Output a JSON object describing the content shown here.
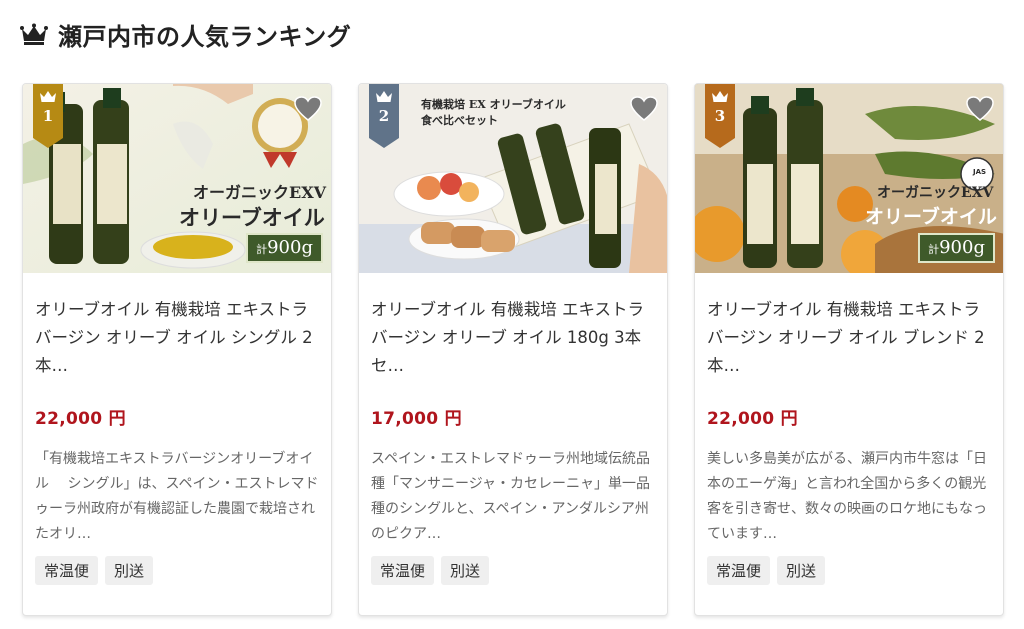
{
  "header": {
    "title": "瀬戸内市の人気ランキング",
    "icon": "crown-icon"
  },
  "colors": {
    "price": "#b0151d",
    "gold": "#b68a14",
    "silver": "#607389",
    "bronze": "#b66a1c"
  },
  "cards": [
    {
      "rank": "1",
      "badge": "gold",
      "image_text": {
        "line1": "オーガニックEXV",
        "line2": "オリーブオイル",
        "weight_prefix": "計",
        "weight": "900g"
      },
      "title": "オリーブオイル 有機栽培 エキストラバージン オリーブ オイル シングル 2本…",
      "price": "22,000 円",
      "description": "「有機栽培エキストラバージンオリーブオイル　 シングル」は、スペイン・エストレマドゥーラ州政府が有機認証した農園で栽培されたオリ…",
      "tags": [
        "常温便",
        "別送"
      ]
    },
    {
      "rank": "2",
      "badge": "silver",
      "image_text": {
        "line1": "有機栽培 EX オリーブオイル",
        "line2": "食べ比べセット"
      },
      "title": "オリーブオイル 有機栽培 エキストラバージン オリーブ オイル 180g 3本 セ…",
      "price": "17,000 円",
      "description": "スペイン・エストレマドゥーラ州地域伝統品種「マンサニージャ・カセレーニャ」単一品種のシングルと、スペイン・アンダルシア州のピクア…",
      "tags": [
        "常温便",
        "別送"
      ]
    },
    {
      "rank": "3",
      "badge": "bronze",
      "image_text": {
        "line1": "オーガニックEXV",
        "line2": "オリーブオイル",
        "weight_prefix": "計",
        "weight": "900g",
        "jas": "JAS"
      },
      "title": "オリーブオイル 有機栽培 エキストラバージン オリーブ オイル ブレンド 2本…",
      "price": "22,000 円",
      "description": "美しい多島美が広がる、瀬戸内市牛窓は「日本のエーゲ海」と言われ全国から多くの観光客を引き寄せ、数々の映画のロケ地にもなっています…",
      "tags": [
        "常温便",
        "別送"
      ]
    }
  ]
}
